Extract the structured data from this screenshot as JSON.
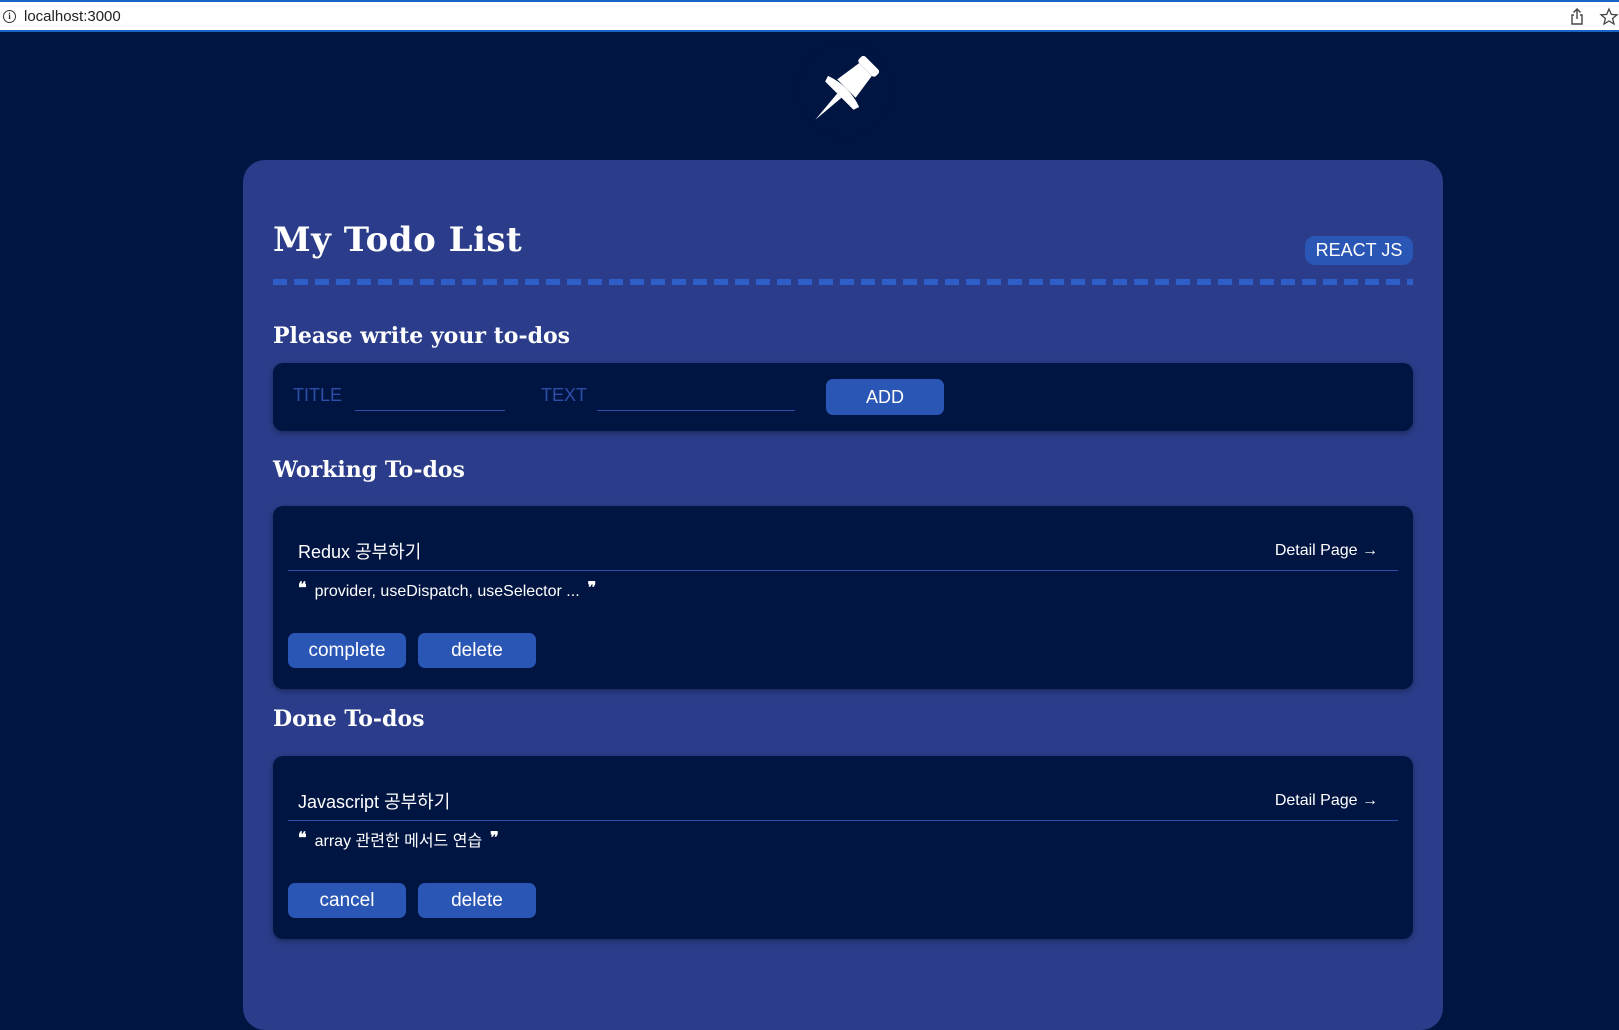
{
  "browser": {
    "url": "localhost:3000"
  },
  "header": {
    "logo_icon": "pushpin-icon",
    "title": "My Todo List",
    "badge": "REACT JS"
  },
  "form": {
    "heading": "Please write your to-dos",
    "title_label": "TITLE",
    "title_value": "",
    "text_label": "TEXT",
    "text_value": "",
    "add_label": "ADD"
  },
  "working": {
    "heading": "Working To-dos",
    "items": [
      {
        "title": "Redux 공부하기",
        "detail_link": "Detail Page →",
        "text": "provider, useDispatch, useSelector ...",
        "primary_button": "complete",
        "delete_button": "delete"
      }
    ]
  },
  "done": {
    "heading": "Done To-dos",
    "items": [
      {
        "title": "Javascript 공부하기",
        "detail_link": "Detail Page →",
        "text": "array 관련한 메서드 연습",
        "primary_button": "cancel",
        "delete_button": "delete"
      }
    ]
  },
  "colors": {
    "page_background": "#011542",
    "card_background": "#2b3d8a",
    "accent_button": "#2a56b5",
    "dashed_line": "#2e5fc9"
  }
}
